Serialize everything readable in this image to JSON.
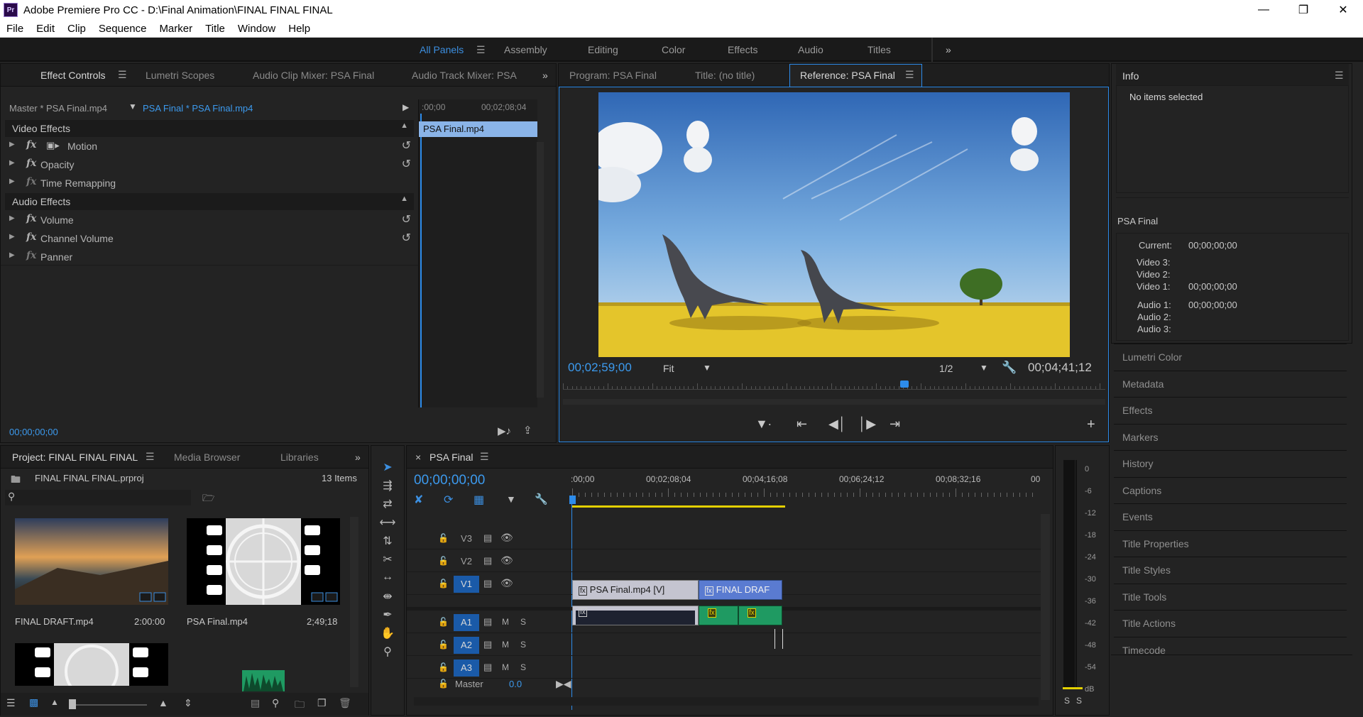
{
  "window": {
    "title": "Adobe Premiere Pro CC - D:\\Final Animation\\FINAL FINAL FINAL",
    "app_icon": "Pr",
    "controls": [
      "minimize",
      "restore",
      "close"
    ]
  },
  "menu": [
    "File",
    "Edit",
    "Clip",
    "Sequence",
    "Marker",
    "Title",
    "Window",
    "Help"
  ],
  "workspaces": {
    "items": [
      "All Panels",
      "Assembly",
      "Editing",
      "Color",
      "Effects",
      "Audio",
      "Titles"
    ],
    "active": "All Panels",
    "more": "»"
  },
  "effect_controls": {
    "tabs": [
      "Effect Controls",
      "Lumetri Scopes",
      "Audio Clip Mixer: PSA Final",
      "Audio Track Mixer: PSA"
    ],
    "master_label": "Master * PSA Final.mp4",
    "clip_label": "PSA Final * PSA Final.mp4",
    "ruler_start": ":00;00",
    "ruler_end": "00;02;08;04",
    "clip_bar": "PSA Final.mp4",
    "video_section": "Video Effects",
    "video_effects": [
      "Motion",
      "Opacity",
      "Time Remapping"
    ],
    "audio_section": "Audio Effects",
    "audio_effects": [
      "Volume",
      "Channel Volume",
      "Panner"
    ],
    "timecode": "00;00;00;00"
  },
  "monitor": {
    "tabs": [
      "Program: PSA Final",
      "Title: (no title)",
      "Reference: PSA Final"
    ],
    "current_time": "00;02;59;00",
    "fit": "Fit",
    "resolution": "1/2",
    "duration": "00;04;41;12",
    "playhead_fraction": 0.63
  },
  "info": {
    "title": "Info",
    "no_items": "No items selected",
    "sequence_name": "PSA Final",
    "current_label": "Current:",
    "current_value": "00;00;00;00",
    "video3": "Video 3:",
    "video2": "Video 2:",
    "video1": "Video 1:",
    "video1_value": "00;00;00;00",
    "audio1": "Audio 1:",
    "audio1_value": "00;00;00;00",
    "audio2": "Audio 2:",
    "audio3": "Audio 3:"
  },
  "side_panels": [
    "Lumetri Color",
    "Metadata",
    "Effects",
    "Markers",
    "History",
    "Captions",
    "Events",
    "Title Properties",
    "Title Styles",
    "Title Tools",
    "Title Actions",
    "Timecode"
  ],
  "project": {
    "tabs": [
      "Project: FINAL FINAL FINAL",
      "Media Browser",
      "Libraries"
    ],
    "file": "FINAL FINAL FINAL.prproj",
    "count": "13 Items",
    "items": [
      {
        "name": "FINAL DRAFT.mp4",
        "duration": "2:00:00"
      },
      {
        "name": "PSA Final.mp4",
        "duration": "2;49;18"
      }
    ]
  },
  "timeline": {
    "tab": "PSA Final",
    "close": "×",
    "timecode": "00;00;00;00",
    "ruler": [
      ":00;00",
      "00;02;08;04",
      "00;04;16;08",
      "00;06;24;12",
      "00;08;32;16",
      "00"
    ],
    "video_tracks": [
      "V3",
      "V2",
      "V1"
    ],
    "audio_tracks": [
      "A1",
      "A2",
      "A3"
    ],
    "mute": "M",
    "solo": "S",
    "master_label": "Master",
    "master_value": "0.0",
    "clips": {
      "v1_a": "PSA Final.mp4 [V]",
      "v1_b": "FINAL DRAF"
    }
  },
  "meter": {
    "labels": [
      "0",
      "-6",
      "-12",
      "-18",
      "-24",
      "-30",
      "-36",
      "-42",
      "-48",
      "-54",
      "dB"
    ],
    "solo_left": "S",
    "solo_right": "S"
  },
  "colors": {
    "accent": "#2d8ceb",
    "panel": "#232323",
    "clip_video": "#b8b8c8",
    "clip_video_b": "#5a7bd1",
    "clip_audio": "#1f9a62"
  }
}
